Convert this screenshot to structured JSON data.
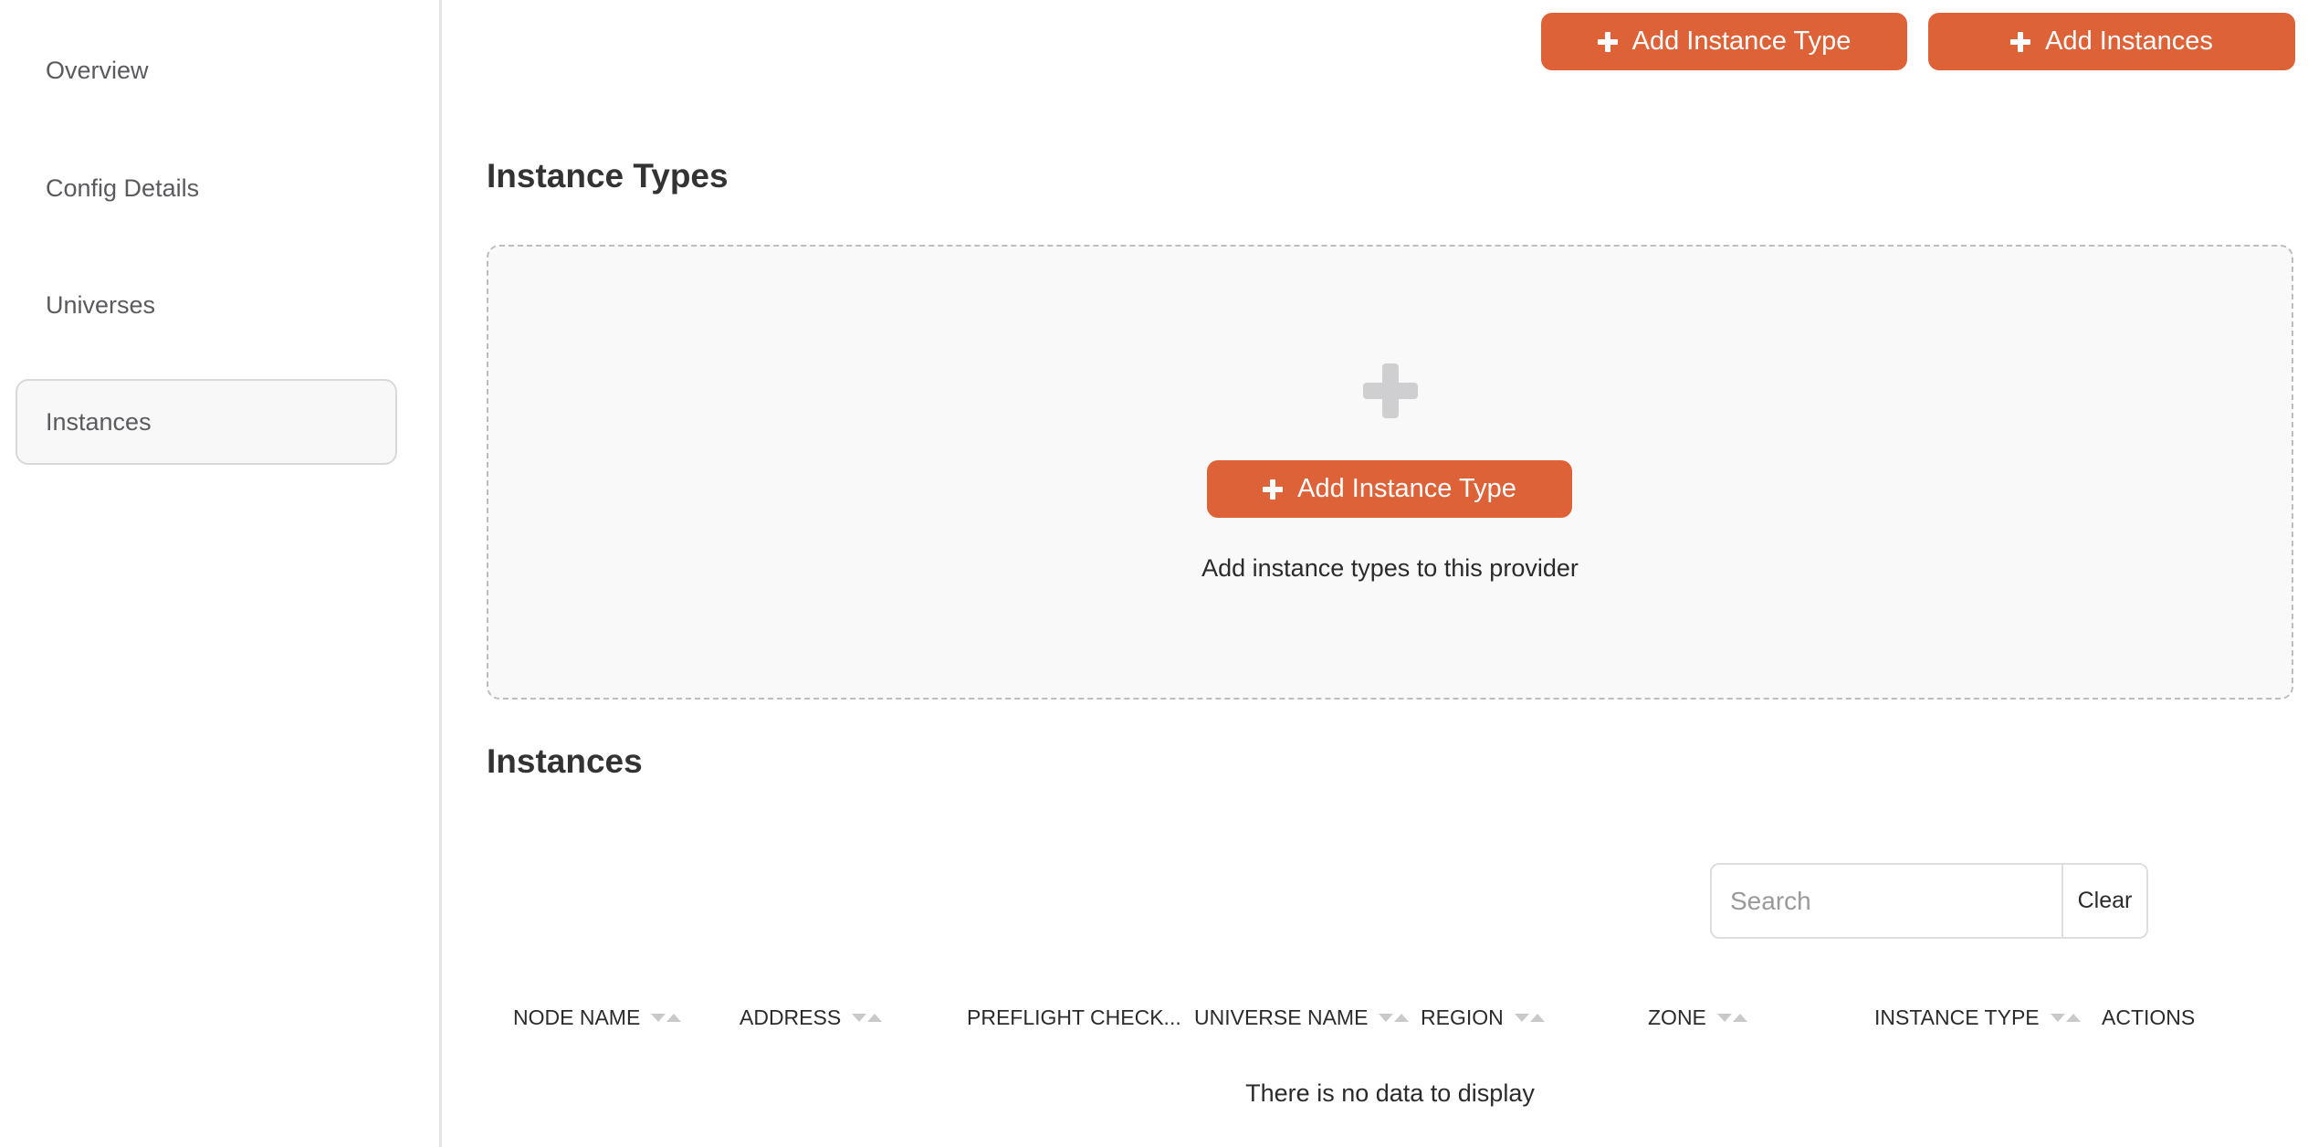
{
  "sidebar": {
    "items": [
      {
        "label": "Overview",
        "active": false
      },
      {
        "label": "Config Details",
        "active": false
      },
      {
        "label": "Universes",
        "active": false
      },
      {
        "label": "Instances",
        "active": true
      }
    ]
  },
  "header": {
    "add_instance_type_label": "Add Instance Type",
    "add_instances_label": "Add Instances"
  },
  "instance_types": {
    "title": "Instance Types",
    "empty_button_label": "Add Instance Type",
    "empty_text": "Add instance types to this provider"
  },
  "instances": {
    "title": "Instances",
    "search": {
      "placeholder": "Search",
      "value": "",
      "clear_label": "Clear"
    },
    "columns": [
      {
        "label": "NODE NAME",
        "sortable": true
      },
      {
        "label": "ADDRESS",
        "sortable": true
      },
      {
        "label": "PREFLIGHT CHECK...",
        "sortable": false
      },
      {
        "label": "UNIVERSE NAME",
        "sortable": true
      },
      {
        "label": "REGION",
        "sortable": true
      },
      {
        "label": "ZONE",
        "sortable": true
      },
      {
        "label": "INSTANCE TYPE",
        "sortable": true
      },
      {
        "label": "ACTIONS",
        "sortable": false
      }
    ],
    "rows": [],
    "empty_message": "There is no data to display"
  },
  "colors": {
    "accent": "#dd6238",
    "sidebar_active_bg": "#f8f8f8",
    "empty_box_bg": "#f9f9f9"
  },
  "icons": {
    "button_plus": "plus-icon",
    "empty_state": "plus-icon",
    "sort": "sort-caret-icon"
  }
}
